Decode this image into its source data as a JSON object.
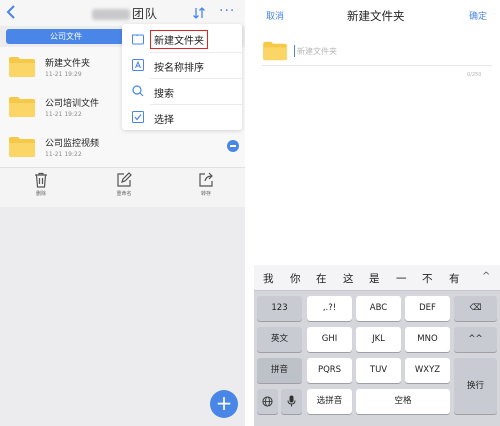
{
  "left": {
    "header": {
      "back_icon": "chevron-left-icon",
      "title": "团队",
      "sort_icon": "sort-icon",
      "more_icon": "more-dots-icon",
      "more_text": "···"
    },
    "tab_label": "公司文件",
    "files": [
      {
        "name": "新建文件夹",
        "date": "11-21 19:29"
      },
      {
        "name": "公司培训文件",
        "date": "11-21 19:22"
      },
      {
        "name": "公司监控视频",
        "date": "11-21 19:22"
      }
    ],
    "actions": [
      {
        "label": "删除",
        "icon": "trash-icon"
      },
      {
        "label": "重命名",
        "icon": "edit-icon"
      },
      {
        "label": "转存",
        "icon": "share-icon"
      }
    ],
    "menu": [
      {
        "label": "新建文件夹",
        "icon": "new-folder-icon"
      },
      {
        "label": "按名称排序",
        "icon": "sort-alpha-icon"
      },
      {
        "label": "搜索",
        "icon": "search-icon"
      },
      {
        "label": "选择",
        "icon": "check-square-icon"
      }
    ],
    "fab_text": "+",
    "accent": "#4a86e8",
    "highlight_border": "#e02424"
  },
  "right": {
    "cancel": "取消",
    "title": "新建文件夹",
    "confirm": "确定",
    "input_placeholder": "新建文件夹",
    "input_value": "",
    "counter": "0/250",
    "candidates": [
      "我",
      "你",
      "在",
      "这",
      "是",
      "一",
      "不",
      "有"
    ],
    "candidates_arrow": "^",
    "keyboard": {
      "row1": [
        "123",
        ",.?!",
        "ABC",
        "DEF",
        "⌫"
      ],
      "row2": [
        "英文",
        "GHI",
        "JKL",
        "MNO",
        "^^"
      ],
      "row3": [
        "拼音",
        "PQRS",
        "TUV",
        "WXYZ"
      ],
      "row4": [
        "🌐",
        "🎤",
        "选拼音",
        "空格"
      ],
      "return": "换行"
    }
  }
}
